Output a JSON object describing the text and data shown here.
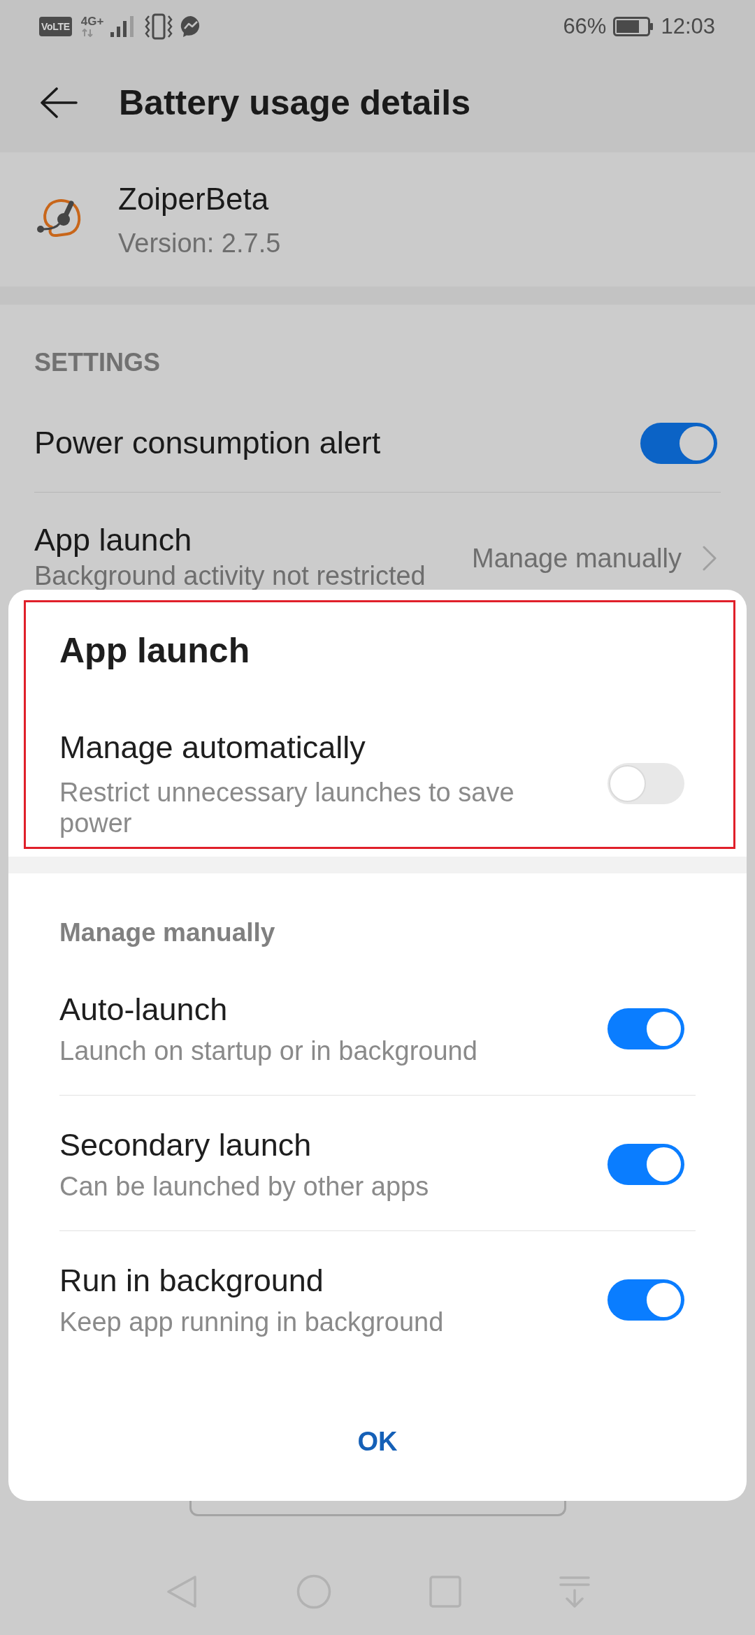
{
  "status_bar": {
    "volte_badge": "VoLTE",
    "network_type": "4G+",
    "battery_percent": "66%",
    "time": "12:03"
  },
  "header": {
    "title": "Battery usage details"
  },
  "app": {
    "name": "ZoiperBeta",
    "version": "Version: 2.7.5"
  },
  "settings": {
    "heading": "SETTINGS",
    "items": [
      {
        "kind": "switch",
        "title": "Power consumption alert",
        "on": true
      },
      {
        "kind": "link",
        "title": "App launch",
        "subtitle": "Background activity not restricted",
        "value": "Manage manually"
      }
    ]
  },
  "dialog": {
    "title": "App launch",
    "highlighted": true,
    "automatic": {
      "title": "Manage automatically",
      "subtitle": "Restrict unnecessary launches to save power",
      "on": false
    },
    "manual": {
      "heading": "Manage manually",
      "items": [
        {
          "title": "Auto-launch",
          "subtitle": "Launch on startup or in background",
          "on": true
        },
        {
          "title": "Secondary launch",
          "subtitle": "Can be launched by other apps",
          "on": true
        },
        {
          "title": "Run in background",
          "subtitle": "Keep app running in background",
          "on": true
        }
      ]
    },
    "button": "OK"
  }
}
